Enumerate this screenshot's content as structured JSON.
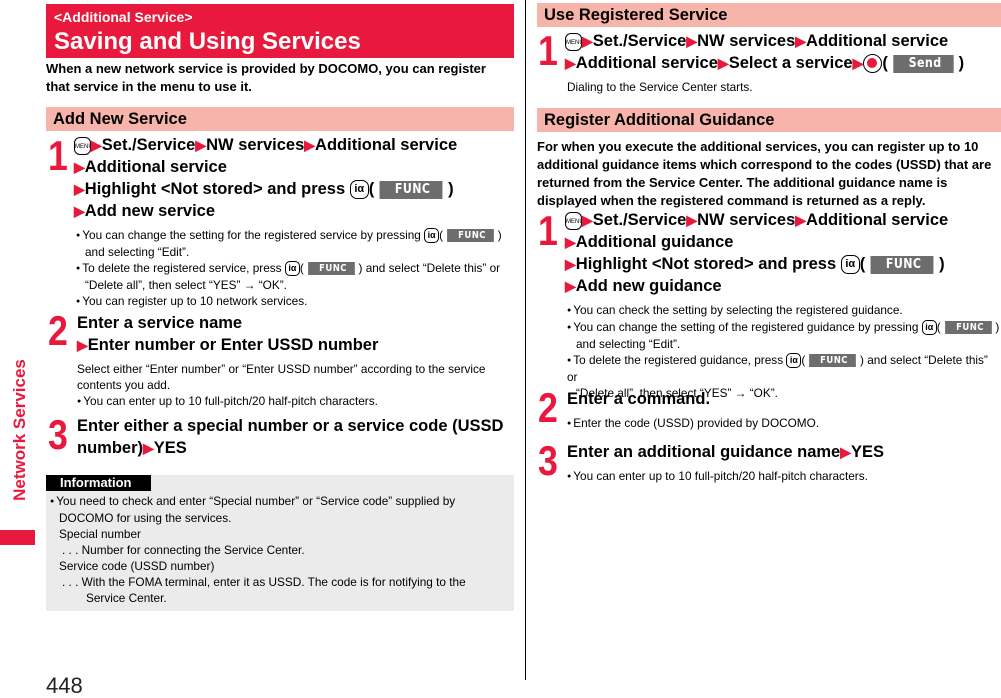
{
  "side_tab": {
    "label": "Network Services",
    "color": "#e8193c"
  },
  "page_number": "448",
  "title": {
    "subtitle": "<Additional Service>",
    "main": "Saving and Using Services"
  },
  "intro": [
    "When a new network service is provided by DOCOMO, you can register",
    "that service in the menu to use it."
  ],
  "keys": {
    "menu": "MENU",
    "i_key": "iα",
    "func": "FUNC",
    "send": "Send",
    "arrow": "▶"
  },
  "add_new_service": {
    "heading": "Add New Service",
    "step1": {
      "number": "1",
      "line1": [
        "Set./Service",
        "NW services",
        "Additional service"
      ],
      "line2": "Additional service",
      "line3": "Highlight <Not stored> and press",
      "line4": "Add new service",
      "notes": [
        {
          "a": "You can change the setting for the registered service by pressing",
          "b": "and selecting “Edit”."
        },
        {
          "a": "To delete the registered service, press",
          "a2": "and select “Delete this” or",
          "b": "“Delete all”, then select “YES” → “OK”."
        },
        {
          "a": "You can register up to 10 network services."
        }
      ]
    },
    "step2": {
      "number": "2",
      "line1": "Enter a service name",
      "line2": "Enter number or Enter USSD number",
      "desc": [
        "Select either “Enter number” or “Enter USSD number” according to the service",
        "contents you add."
      ],
      "note": "You can enter up to 10 full-pitch/20 half-pitch characters."
    },
    "step3": {
      "number": "3",
      "line1": "Enter either a special number or a service code (USSD",
      "line2": "number)",
      "line2_end": "YES"
    }
  },
  "information": {
    "tag": "Information",
    "lines": [
      "You need to check and enter “Special number” or “Service code” supplied by",
      "DOCOMO for using the services.",
      "Special number",
      ". . .  Number for connecting the Service Center.",
      "Service code (USSD number)",
      ". . .  With the FOMA terminal, enter it as USSD. The code is for notifying to the",
      "Service Center."
    ]
  },
  "use_registered": {
    "heading": "Use Registered Service",
    "step1": {
      "number": "1",
      "line1": [
        "Set./Service",
        "NW services",
        "Additional service"
      ],
      "line2": [
        "Additional service",
        "Select a service"
      ],
      "desc": "Dialing to the Service Center starts."
    }
  },
  "register_guidance": {
    "heading": "Register Additional Guidance",
    "intro": [
      "For when you execute the additional services, you can register up to 10",
      "additional guidance items which correspond to the codes (USSD) that are",
      "returned from the Service Center. The additional guidance name is",
      "displayed when the registered command is returned as a reply."
    ],
    "step1": {
      "number": "1",
      "line1": [
        "Set./Service",
        "NW services",
        "Additional service"
      ],
      "line2": "Additional guidance",
      "line3": "Highlight <Not stored> and press",
      "line4": "Add new guidance",
      "notes": [
        {
          "a": "You can check the setting by selecting the registered guidance."
        },
        {
          "a": "You can change the setting of the registered guidance by pressing",
          "b": "and selecting “Edit”."
        },
        {
          "a": "To delete the registered guidance, press",
          "a2": "and select “Delete this” or",
          "b": "“Delete all”, then select “YES” → “OK”."
        }
      ]
    },
    "step2": {
      "number": "2",
      "line1": "Enter a command.",
      "note": "Enter the code (USSD) provided by DOCOMO."
    },
    "step3": {
      "number": "3",
      "line1": "Enter an additional guidance name",
      "line1_end": "YES",
      "note": "You can enter up to 10 full-pitch/20 half-pitch characters."
    }
  }
}
